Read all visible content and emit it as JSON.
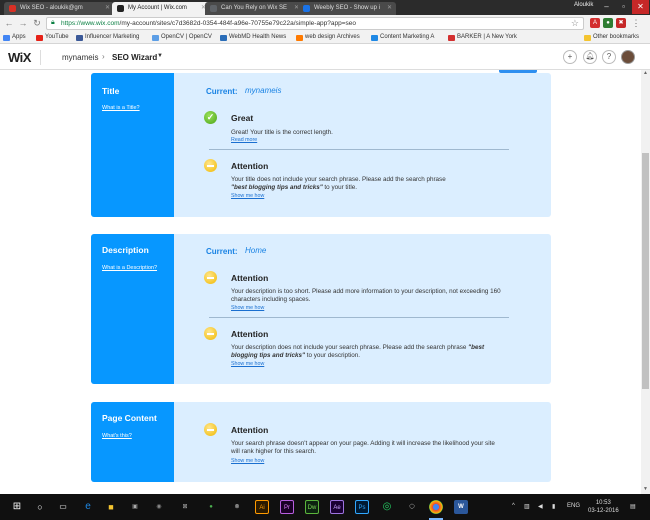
{
  "browser": {
    "tabs": [
      {
        "title": "Wix SEO - aloukik@gm",
        "active": false,
        "favicon_color": "#d93025"
      },
      {
        "title": "My Account | Wix.com",
        "active": true,
        "favicon_color": "#222222"
      },
      {
        "title": "Can You Rely on Wix SE",
        "active": false,
        "favicon_color": "#5f6368"
      },
      {
        "title": "Weebly SEO - Show up i",
        "active": false,
        "favicon_color": "#1a73e8"
      }
    ],
    "profile_name": "Aloukik",
    "url_host": "https://www.wix.com",
    "url_path": "/my-account/sites/c7d3682d-0354-484f-a96e-70755e79c22a/simple-app?app=seo",
    "bookmarks": [
      {
        "label": "Apps",
        "color": "#4285f4"
      },
      {
        "label": "YouTube",
        "color": "#e62117"
      },
      {
        "label": "Influencer Marketing",
        "color": "#3b5998"
      },
      {
        "label": "OpenCV | OpenCV",
        "color": "#5c9ee6"
      },
      {
        "label": "WebMD Health News",
        "color": "#2a6db8"
      },
      {
        "label": "web design Archives",
        "color": "#ff7a00"
      },
      {
        "label": "Content Marketing A",
        "color": "#1e88e5"
      },
      {
        "label": "BARKER | A New York",
        "color": "#d32f2f"
      }
    ],
    "other_bookmarks": "Other bookmarks"
  },
  "wix": {
    "logo": "WiX",
    "site_name": "mynameis",
    "app_name": "SEO Wizard",
    "icons": {
      "add": "+",
      "notifications": "bell-icon",
      "help": "?"
    }
  },
  "cards": {
    "title": {
      "heading": "Title",
      "link": "What is a Title?",
      "current_label": "Current:",
      "current_value": "mynameis",
      "items": [
        {
          "status": "Great",
          "text": "Great! Your title is the correct length.",
          "link": "Read more"
        },
        {
          "status": "Attention",
          "text_before": "Your title does not include your search phrase. Please add the search phrase",
          "phrase": "\"best blogging tips and tricks\"",
          "text_after": " to your title.",
          "link": "Show me how"
        }
      ]
    },
    "description": {
      "heading": "Description",
      "link": "What is a Description?",
      "current_label": "Current:",
      "current_value": "Home",
      "items": [
        {
          "status": "Attention",
          "text": "Your description is too short. Please add more information to your description, not exceeding 160 characters including spaces.",
          "link": "Show me how"
        },
        {
          "status": "Attention",
          "text_before": "Your description does not include your search phrase. Please add the search phrase ",
          "phrase": "\"best blogging tips and tricks\"",
          "text_after": " to your description.",
          "link": "Show me how"
        }
      ]
    },
    "content": {
      "heading": "Page Content",
      "link": "What's this?",
      "items": [
        {
          "status": "Attention",
          "text": "Your search phrase doesn't appear on your page. Adding it will increase the likelihood your site will rank higher for this search.",
          "link": "Show me how"
        }
      ]
    }
  },
  "taskbar": {
    "language": "ENG",
    "time": "10:53",
    "date": "03-12-2016"
  }
}
